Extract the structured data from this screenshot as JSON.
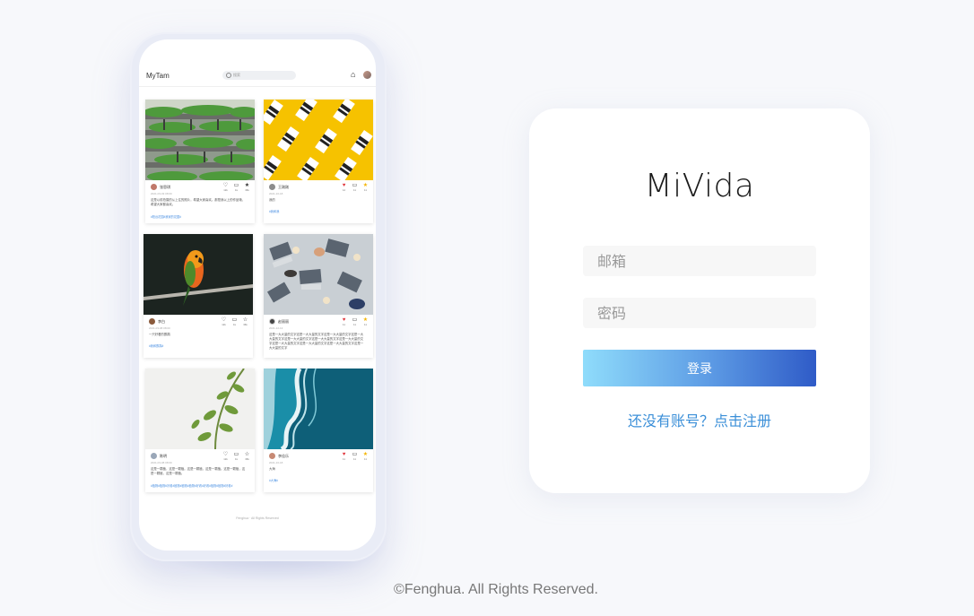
{
  "phone": {
    "brand": "MyTam",
    "search_placeholder": "搜索",
    "icons": {
      "home": "home-icon",
      "avatar": "avatar"
    },
    "footer": "Fenghua · All Rights Reserved",
    "cards": [
      {
        "name": "张思琪",
        "time": "2021-03-03 08:00",
        "text": "这是以前拍摄的从上往的照片，希望大家喜欢。那是我以上的作品哦，希望大家都喜欢。",
        "link": "#阳台花园#我家的花园#",
        "counts": [
          "12k",
          "1k",
          "36k"
        ],
        "liked": false,
        "photo": "green-building"
      },
      {
        "name": "王刚刚",
        "time": "2021-10-18",
        "text": "我的",
        "link": "#我和我",
        "counts": [
          "12",
          "11",
          "11"
        ],
        "liked": true,
        "photo": "yellow-cartons"
      },
      {
        "name": "李白",
        "time": "2021-03-08 08:00",
        "text": "一只好看的鹦鹉",
        "link": "#我和鹦鹉#",
        "counts": [
          "12k",
          "1k",
          "36k"
        ],
        "liked": false,
        "photo": "parrot"
      },
      {
        "name": "赵丽丽",
        "time": "2021-12-13",
        "text": "这是一大大量的文字这是一大大量的文字这是一大大量的文字这是一大大量的文字这是一大大量的文字这是一大大量的文字这是一大大量的文字这是一大大量的文字这是一大大量的文字这是一大大量的文字这是一大大量的文字",
        "link": "",
        "counts": [
          "11",
          "11",
          "11"
        ],
        "liked": true,
        "photo": "office-desk"
      },
      {
        "name": "陈明",
        "time": "2021-03-08 08:00",
        "text": "这是一颗植，这是一颗植。这是一颗植，这是一颗植。这是一颗植，这是一颗植，这是一颗植。",
        "link": "#植物#植物#好看#植物#植物#植物#好看#好看#植物#植物#好看#",
        "counts": [
          "12k",
          "1k",
          "36k"
        ],
        "liked": false,
        "photo": "plant"
      },
      {
        "name": "李佳乐",
        "time": "2021-10-18",
        "text": "大海",
        "link": "#大海#",
        "counts": [
          "11",
          "11",
          "11"
        ],
        "liked": true,
        "photo": "ocean"
      }
    ]
  },
  "login": {
    "logo": "MiVida",
    "email_placeholder": "邮箱",
    "password_placeholder": "密码",
    "button": "登录",
    "register_link": "还没有账号？点击注册"
  },
  "footer": "©Fenghua. All Rights Reserved.",
  "colors": {
    "accent_start": "#8fdcfb",
    "accent_end": "#2f5bc7",
    "link": "#3b8fd8",
    "background": "#f7f8fb"
  }
}
